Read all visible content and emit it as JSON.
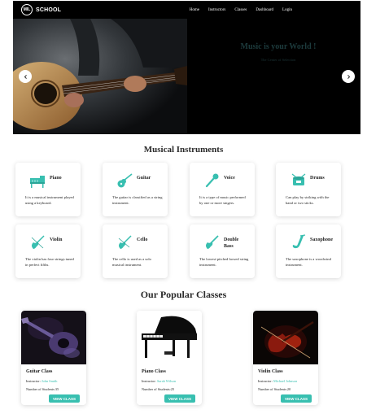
{
  "brand": {
    "logo_mark": "MIL",
    "name": "SCHOOL"
  },
  "nav": {
    "items": [
      "Home",
      "Instructors",
      "Classes",
      "Dashboard",
      "Login"
    ]
  },
  "hero": {
    "title": "Music is your World !",
    "subtitle": "The Center of Selection"
  },
  "instruments": {
    "title": "Musical Instruments",
    "items": [
      {
        "name": "Piano",
        "desc": "It is a musical instrument played using a keyboard.",
        "icon": "piano-icon"
      },
      {
        "name": "Guitar",
        "desc": "The guitar is classified as a string instrument.",
        "icon": "guitar-icon"
      },
      {
        "name": "Voice",
        "desc": "It is a type of music performed by one or more singers.",
        "icon": "microphone-icon"
      },
      {
        "name": "Drums",
        "desc": "Can play by striking with the hand or two sticks.",
        "icon": "drums-icon"
      },
      {
        "name": "Violin",
        "desc": "The violin has four strings tuned in perfect fifths.",
        "icon": "violin-icon"
      },
      {
        "name": "Cello",
        "desc": "The cello is used as a solo musical instrument.",
        "icon": "cello-icon"
      },
      {
        "name": "Double Bass",
        "desc": "The lowest-pitched bowed string instrument.",
        "icon": "double-bass-icon"
      },
      {
        "name": "Saxophone",
        "desc": "The saxophone is a woodwind instrument.",
        "icon": "saxophone-icon"
      }
    ]
  },
  "classes": {
    "title": "Our Popular Classes",
    "button_label": "VIEW CLASS",
    "instructor_label": "Instructor:",
    "students_label": "Number of Students:",
    "items": [
      {
        "name": "Guitar Class",
        "instructor": "John Smith",
        "students": "35"
      },
      {
        "name": "Piano Class",
        "instructor": "Sarah Wilson",
        "students": "25"
      },
      {
        "name": "Violin Class",
        "instructor": "Michael Johnson",
        "students": "20"
      }
    ]
  },
  "colors": {
    "accent": "#38bfb0",
    "nav_bg": "#000000",
    "hero_text": "#1d3b3d"
  }
}
